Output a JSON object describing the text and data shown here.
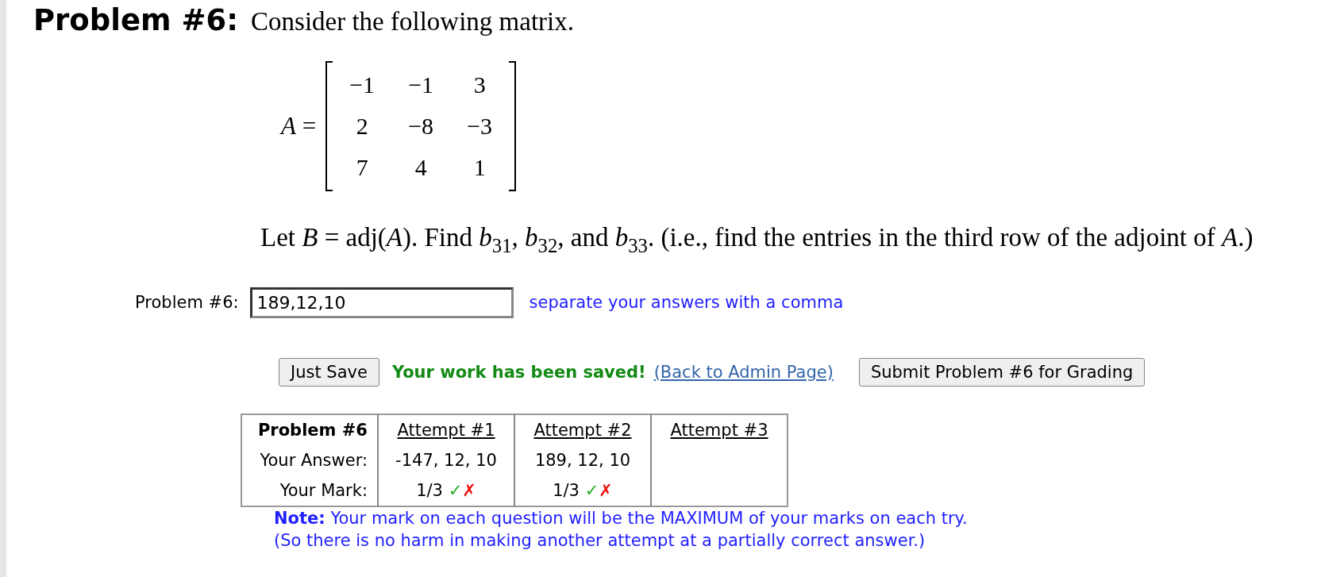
{
  "problem": {
    "heading": "Problem #6:",
    "intro": "Consider the following matrix.",
    "matrix": {
      "name": "A",
      "equals": "=",
      "rows": [
        [
          "−1",
          "−1",
          "3"
        ],
        [
          "2",
          "−8",
          "−3"
        ],
        [
          "7",
          "4",
          "1"
        ]
      ]
    },
    "question": "Let *B* = adj(*A*). Find *b*$_{31}$, *b*$_{32}$, and *b*$_{33}$. (i.e., find the entries in the third row of the adjoint of *A*.)"
  },
  "answer": {
    "label": "Problem #6:",
    "value": "189,12,10",
    "hint": "separate your answers with a comma"
  },
  "actions": {
    "save_button": "Just Save",
    "status": "Your work has been saved!",
    "link": "(Back to Admin Page)",
    "submit_button": "Submit Problem #6 for Grading"
  },
  "attempts": {
    "corner": "Problem #6",
    "columns": [
      "Attempt #1",
      "Attempt #2",
      "Attempt #3"
    ],
    "answer_label": "Your Answer:",
    "mark_label": "Your Mark:",
    "entries": [
      {
        "answer": "-147, 12, 10",
        "mark": "1/3",
        "symbols": [
          {
            "kind": "correct",
            "text": "✓"
          },
          {
            "kind": "wrong",
            "text": "✗"
          }
        ]
      },
      {
        "answer": "189, 12, 10",
        "mark": "1/3",
        "symbols": [
          {
            "kind": "correct",
            "text": "✓"
          },
          {
            "kind": "wrong",
            "text": "✗"
          }
        ]
      }
    ]
  },
  "note": {
    "label": "Note:",
    "text": "Your mark on each question will be the MAXIMUM of your marks on each try.",
    "text_2": "(So there is no harm in making another attempt at a partially correct answer.)"
  }
}
